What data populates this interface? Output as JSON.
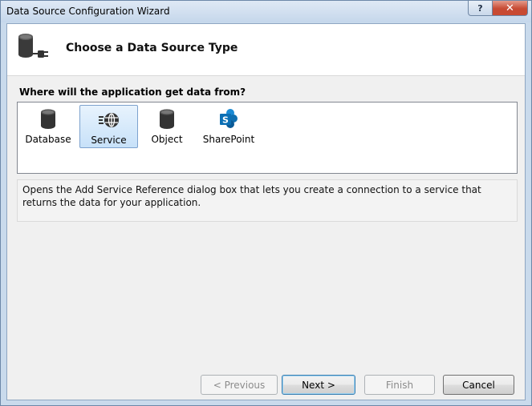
{
  "window": {
    "title": "Data Source Configuration Wizard",
    "help_glyph": "?",
    "close_glyph": "✕"
  },
  "header": {
    "title": "Choose a Data Source Type",
    "icon": "database-plug-icon"
  },
  "prompt": "Where will the application get data from?",
  "sources": [
    {
      "label": "Database",
      "icon": "database-icon",
      "selected": false
    },
    {
      "label": "Service",
      "icon": "service-globe-icon",
      "selected": true
    },
    {
      "label": "Object",
      "icon": "object-icon",
      "selected": false
    },
    {
      "label": "SharePoint",
      "icon": "sharepoint-icon",
      "selected": false
    }
  ],
  "description": "Opens the Add Service Reference dialog box that lets you create a connection to a service that returns the data for your application.",
  "buttons": {
    "previous": "< Previous",
    "next": "Next >",
    "finish": "Finish",
    "cancel": "Cancel"
  },
  "colors": {
    "selection": "#c7e1f9",
    "sharepoint_blue": "#0b6fb5"
  }
}
